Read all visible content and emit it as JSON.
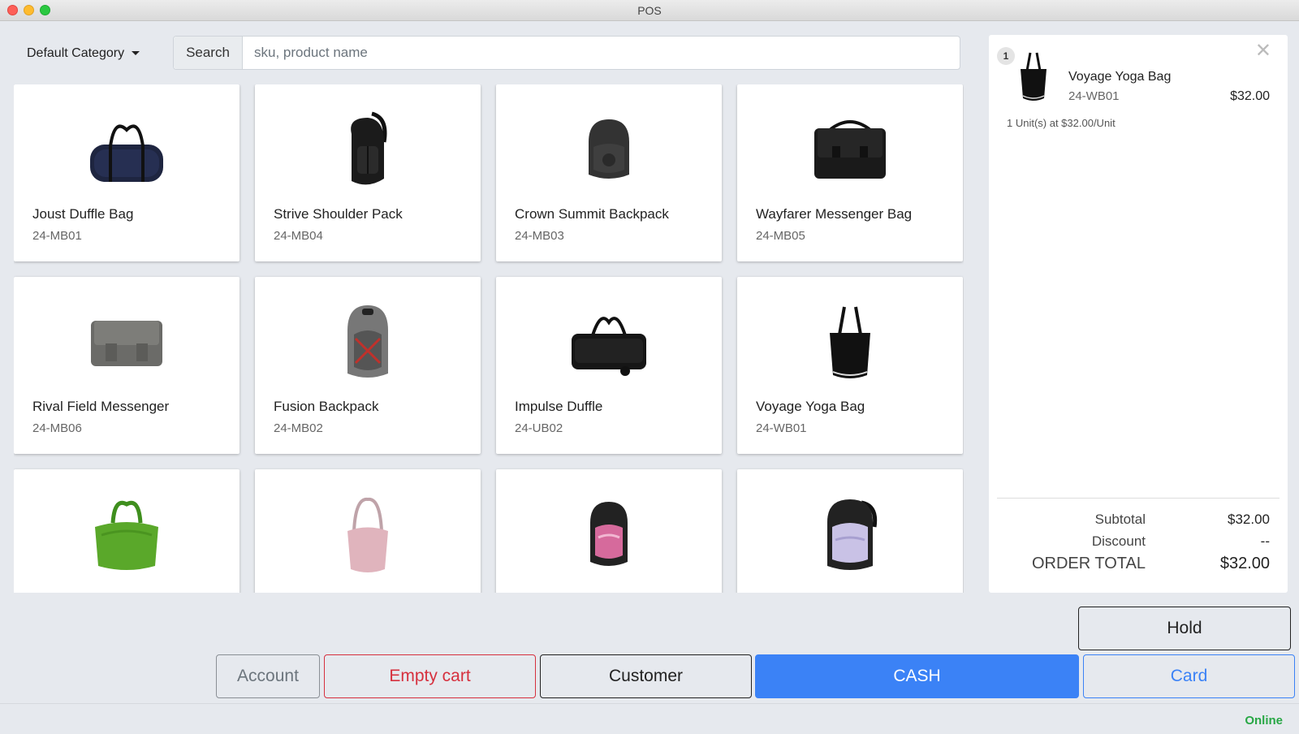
{
  "window": {
    "title": "POS"
  },
  "toolbar": {
    "category_label": "Default Category",
    "search_label": "Search",
    "search_placeholder": "sku, product name",
    "search_value": ""
  },
  "products": [
    {
      "name": "Joust Duffle Bag",
      "sku": "24-MB01",
      "icon": "duffle-bag-icon"
    },
    {
      "name": "Strive Shoulder Pack",
      "sku": "24-MB04",
      "icon": "sling-backpack-icon"
    },
    {
      "name": "Crown Summit Backpack",
      "sku": "24-MB03",
      "icon": "backpack-icon"
    },
    {
      "name": "Wayfarer Messenger Bag",
      "sku": "24-MB05",
      "icon": "messenger-bag-icon"
    },
    {
      "name": "Rival Field Messenger",
      "sku": "24-MB06",
      "icon": "messenger-bag-icon"
    },
    {
      "name": "Fusion Backpack",
      "sku": "24-MB02",
      "icon": "backpack-icon"
    },
    {
      "name": "Impulse Duffle",
      "sku": "24-UB02",
      "icon": "rolling-duffle-icon"
    },
    {
      "name": "Voyage Yoga Bag",
      "sku": "24-WB01",
      "icon": "tote-bag-icon"
    },
    {
      "name": "",
      "sku": "",
      "icon": "gym-bag-icon"
    },
    {
      "name": "",
      "sku": "",
      "icon": "shoulder-bag-icon"
    },
    {
      "name": "",
      "sku": "",
      "icon": "backpack-icon"
    },
    {
      "name": "",
      "sku": "",
      "icon": "backpack-icon"
    }
  ],
  "cart": {
    "items": [
      {
        "qty": "1",
        "name": "Voyage Yoga Bag",
        "sku": "24-WB01",
        "price": "$32.00",
        "unit_text": "1 Unit(s) at $32.00/Unit",
        "icon": "tote-bag-icon"
      }
    ],
    "remove_icon": "close-icon",
    "subtotal_label": "Subtotal",
    "subtotal_value": "$32.00",
    "discount_label": "Discount",
    "discount_value": "--",
    "total_label": "ORDER TOTAL",
    "total_value": "$32.00"
  },
  "actions": {
    "hold": "Hold",
    "account": "Account",
    "empty_cart": "Empty cart",
    "customer": "Customer",
    "cash": "CASH",
    "card": "Card"
  },
  "status": {
    "connection": "Online",
    "connection_color": "#28a745"
  },
  "colors": {
    "primary": "#3b82f6",
    "danger": "#d6303e",
    "background": "#e6e9ee"
  }
}
